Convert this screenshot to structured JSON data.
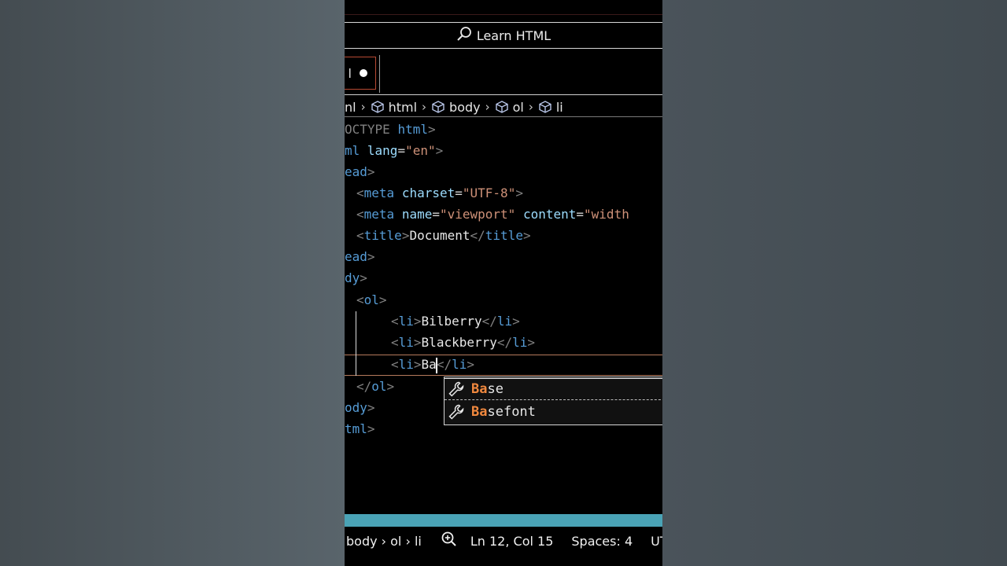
{
  "window": {
    "search_label": "Learn HTML",
    "search_icon": "search-icon",
    "tab_label_fragment": "l",
    "tab_modified_icon": "unsaved-dot-icon"
  },
  "breadcrumb": [
    {
      "label": "nl",
      "icon": ""
    },
    {
      "label": "html",
      "icon": "cube-icon"
    },
    {
      "label": "body",
      "icon": "cube-icon"
    },
    {
      "label": "ol",
      "icon": "cube-icon"
    },
    {
      "label": "li",
      "icon": "cube-icon"
    }
  ],
  "code": {
    "l1_a": "OCTYPE ",
    "l1_b": "html",
    "l2_a": "ml ",
    "l2_attr": "lang",
    "l2_eq": "=",
    "l2_val": "\"en\"",
    "l3": "ead",
    "l4_tag": "meta",
    "l4_attr": "charset",
    "l4_val": "\"UTF-8\"",
    "l5_tag": "meta",
    "l5_attr1": "name",
    "l5_val1": "\"viewport\"",
    "l5_attr2": "content",
    "l5_val2": "\"width",
    "l6_tag": "title",
    "l6_text": "Document",
    "l7": "ead",
    "l8": "dy",
    "l9": "ol",
    "l10_tag": "li",
    "l10_text": "Bilberry",
    "l11_tag": "li",
    "l11_text": "Blackberry",
    "l12_tag": "li",
    "l12_text": "Ba",
    "l13": "ol",
    "l14": "ody",
    "l15": "tml"
  },
  "suggestions": [
    {
      "match": "Ba",
      "rest": "se",
      "icon": "wrench-icon"
    },
    {
      "match": "Ba",
      "rest": "sefont",
      "icon": "wrench-icon"
    }
  ],
  "status": {
    "path": "body › ol › li",
    "zoom_icon": "zoom-icon",
    "position": "Ln 12, Col 15",
    "spaces": "Spaces: 4",
    "encoding": "UTF"
  },
  "colors": {
    "accent_status": "#4aa3b6",
    "tab_border": "#b84a33",
    "tag_name": "#569cd6",
    "attr_value": "#ce9178",
    "suggest_highlight": "#f0883e"
  }
}
